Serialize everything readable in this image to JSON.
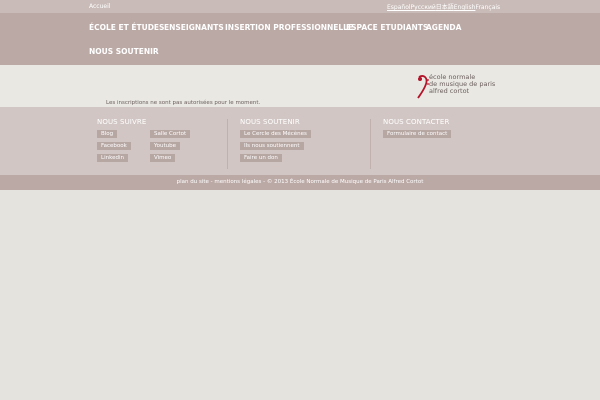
{
  "topbar": {
    "home": "Accueil",
    "languages": [
      "Español",
      "Русский",
      "日本語",
      "English",
      "Français"
    ]
  },
  "nav": {
    "items": [
      "ÉCOLE ET ÉTUDES",
      "ENSEIGNANTS",
      "INSERTION PROFESSIONNELLE",
      "ESPACE ETUDIANTS",
      "AGENDA",
      "NOUS SOUTENIR"
    ]
  },
  "content": {
    "logo_lines": [
      "école normale",
      "de musique de paris",
      "alfred cortot"
    ],
    "notice": "Les inscriptions ne sont pas autorisées pour le moment."
  },
  "footer": {
    "follow": {
      "title": "NOUS SUIVRE",
      "links": [
        "Blog",
        "Salle Cortot",
        "Facebook",
        "Youtube",
        "Linkedin",
        "Vimeo"
      ]
    },
    "support": {
      "title": "NOUS SOUTENIR",
      "links": [
        "Le Cercle des Mécènes",
        "Ils nous soutiennent",
        "Faire un don"
      ]
    },
    "contact": {
      "title": "NOUS CONTACTER",
      "links": [
        "Formulaire de contact"
      ]
    }
  },
  "bottom": {
    "sitemap": "plan du site",
    "legal": "mentions légales",
    "copyright": "© 2013 École Normale de Musique de Paris Alfred Cortot"
  },
  "colors": {
    "nav_bg": "#bba9a5",
    "footer_bg": "#d1c6c3",
    "logo_red": "#b3142a"
  }
}
